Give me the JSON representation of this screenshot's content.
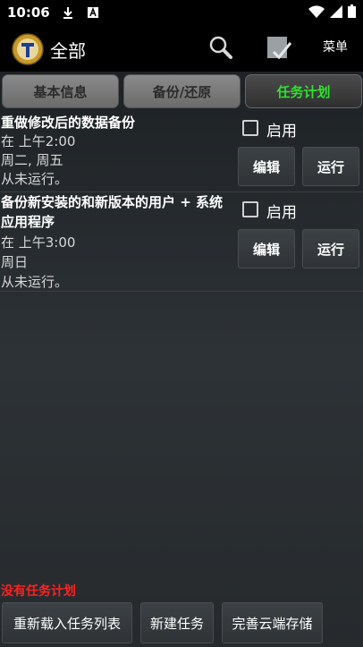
{
  "status": {
    "time": "10:06",
    "icons": [
      "download-icon",
      "font-app-icon",
      "wifi-icon",
      "signal-icon",
      "battery-icon"
    ]
  },
  "appbar": {
    "title": "全部",
    "menu_label": "菜单",
    "icons": [
      "titanium-logo-icon",
      "search-icon",
      "check-filter-icon"
    ]
  },
  "tabs": [
    {
      "label": "基本信息",
      "active": false
    },
    {
      "label": "备份/还原",
      "active": false
    },
    {
      "label": "任务计划",
      "active": true
    }
  ],
  "tasks": [
    {
      "title": "重做修改后的数据备份",
      "time": "在 上午2:00",
      "days": "周二, 周五",
      "last_run": "从未运行。",
      "enabled": false,
      "enable_label": "启用",
      "edit_label": "编辑",
      "run_label": "运行"
    },
    {
      "title": "备份新安装的和新版本的用户 + 系统应用程序",
      "time": "在 上午3:00",
      "days": "周日",
      "last_run": "从未运行。",
      "enabled": false,
      "enable_label": "启用",
      "edit_label": "编辑",
      "run_label": "运行"
    }
  ],
  "footer": {
    "empty_message": "没有任务计划",
    "reload_label": "重新载入任务列表",
    "new_task_label": "新建任务",
    "cloud_label": "完善云端存储"
  },
  "colors": {
    "active_tab_text": "#2fe02f",
    "empty_message": "#ff2222",
    "background": "#2d3236"
  }
}
